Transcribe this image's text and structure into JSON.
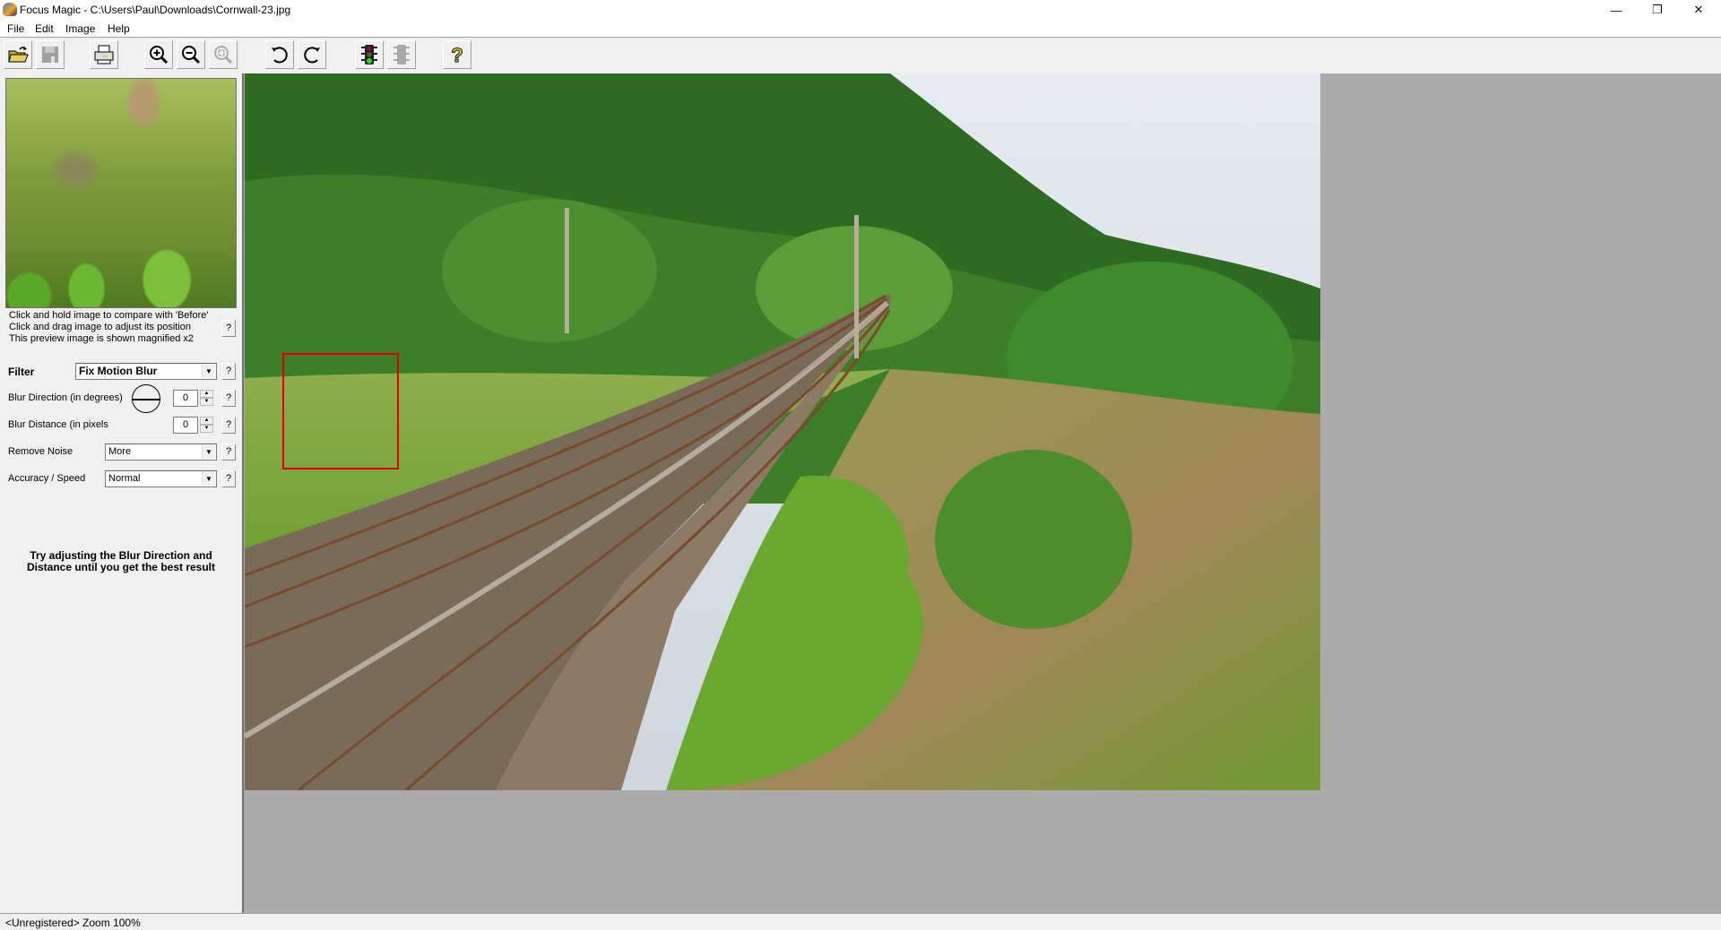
{
  "window": {
    "title": "Focus Magic - C:\\Users\\Paul\\Downloads\\Cornwall-23.jpg",
    "controls": {
      "minimize": "—",
      "restore": "❐",
      "close": "✕"
    }
  },
  "menu": {
    "items": [
      "File",
      "Edit",
      "Image",
      "Help"
    ]
  },
  "toolbar": {
    "buttons": [
      {
        "name": "open",
        "icon": "open-folder-icon",
        "enabled": true
      },
      {
        "name": "save",
        "icon": "floppy-disk-icon",
        "enabled": false
      },
      {
        "name": "print",
        "icon": "printer-icon",
        "enabled": true
      },
      {
        "name": "zoom-in",
        "icon": "zoom-in-icon",
        "enabled": true
      },
      {
        "name": "zoom-out",
        "icon": "zoom-out-icon",
        "enabled": true
      },
      {
        "name": "zoom-fit",
        "icon": "zoom-fit-icon",
        "enabled": false
      },
      {
        "name": "rotate-left",
        "icon": "rotate-left-icon",
        "enabled": true
      },
      {
        "name": "rotate-right",
        "icon": "rotate-right-icon",
        "enabled": true
      },
      {
        "name": "process",
        "icon": "traffic-light-icon",
        "enabled": true
      },
      {
        "name": "stop",
        "icon": "traffic-light-disabled-icon",
        "enabled": false
      },
      {
        "name": "help",
        "icon": "help-question-icon",
        "enabled": true
      }
    ]
  },
  "panel": {
    "hint_lines": [
      "Click and hold image to compare with 'Before'",
      "Click and drag image to adjust its position",
      "This preview image is shown magnified x2"
    ],
    "help_label": "?",
    "filter": {
      "label": "Filter",
      "value": "Fix Motion Blur"
    },
    "blur_direction": {
      "label": "Blur Direction (in degrees)",
      "value": "0"
    },
    "blur_distance": {
      "label": "Blur Distance (in pixels",
      "value": "0"
    },
    "remove_noise": {
      "label": "Remove Noise",
      "value": "More"
    },
    "accuracy_speed": {
      "label": "Accuracy / Speed",
      "value": "Normal"
    },
    "tip_lines": [
      "Try adjusting the Blur Direction and",
      "Distance until you get the best result"
    ]
  },
  "canvas": {
    "image_name": "Cornwall-23.jpg",
    "selection_color": "#e00000"
  },
  "status": {
    "text": "<Unregistered>  Zoom 100%"
  }
}
